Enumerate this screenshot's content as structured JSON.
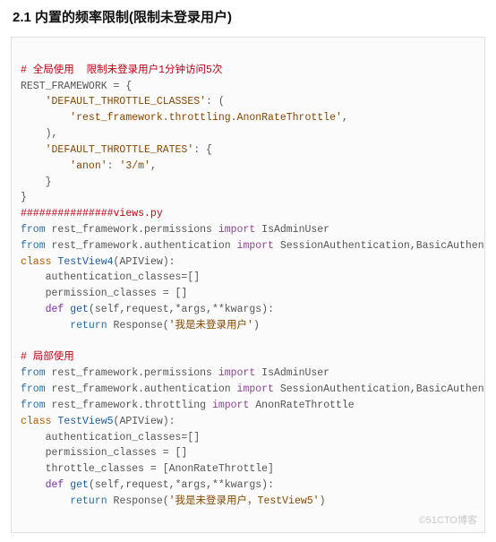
{
  "heading": "2.1 内置的频率限制(限制未登录用户)",
  "watermark": "©51CTO博客",
  "code": {
    "c1": "# 全局使用  限制未登录用户1分钟访问5次",
    "l2": "REST_FRAMEWORK = {",
    "k3": "'DEFAULT_THROTTLE_CLASSES'",
    "l3b": ": (",
    "s4": "'rest_framework.throttling.AnonRateThrottle'",
    "l4b": ",",
    "l5": "    ),",
    "k6": "'DEFAULT_THROTTLE_RATES'",
    "l6b": ": {",
    "s7a": "'anon'",
    "l7b": ": ",
    "s7c": "'3/m'",
    "l7d": ",",
    "l8": "    }",
    "l9": "}",
    "c10": "###############views.py",
    "kw_from": "from",
    "kw_import": "import",
    "kw_class": "class",
    "kw_def": "def",
    "kw_return": "return",
    "m11a": " rest_framework.permissions ",
    "m11b": " IsAdminUser",
    "m12a": " rest_framework.authentication ",
    "m12b": " SessionAuthentication,BasicAuthentication",
    "cls13a": "TestView4",
    "cls13b": "(APIView):",
    "l14": "    authentication_classes=[]",
    "l15": "    permission_classes = []",
    "def16a": "get",
    "def16b": "(self,request,*args,**kwargs):",
    "ret17a": " Response(",
    "ret17b": "'我是未登录用户'",
    "ret17c": ")",
    "c18": "# 局部使用",
    "m21a": " rest_framework.throttling ",
    "m21b": " AnonRateThrottle",
    "cls22a": "TestView5",
    "l25": "    throttle_classes = [AnonRateThrottle]",
    "ret27b": "'我是未登录用户，TestView5'"
  }
}
